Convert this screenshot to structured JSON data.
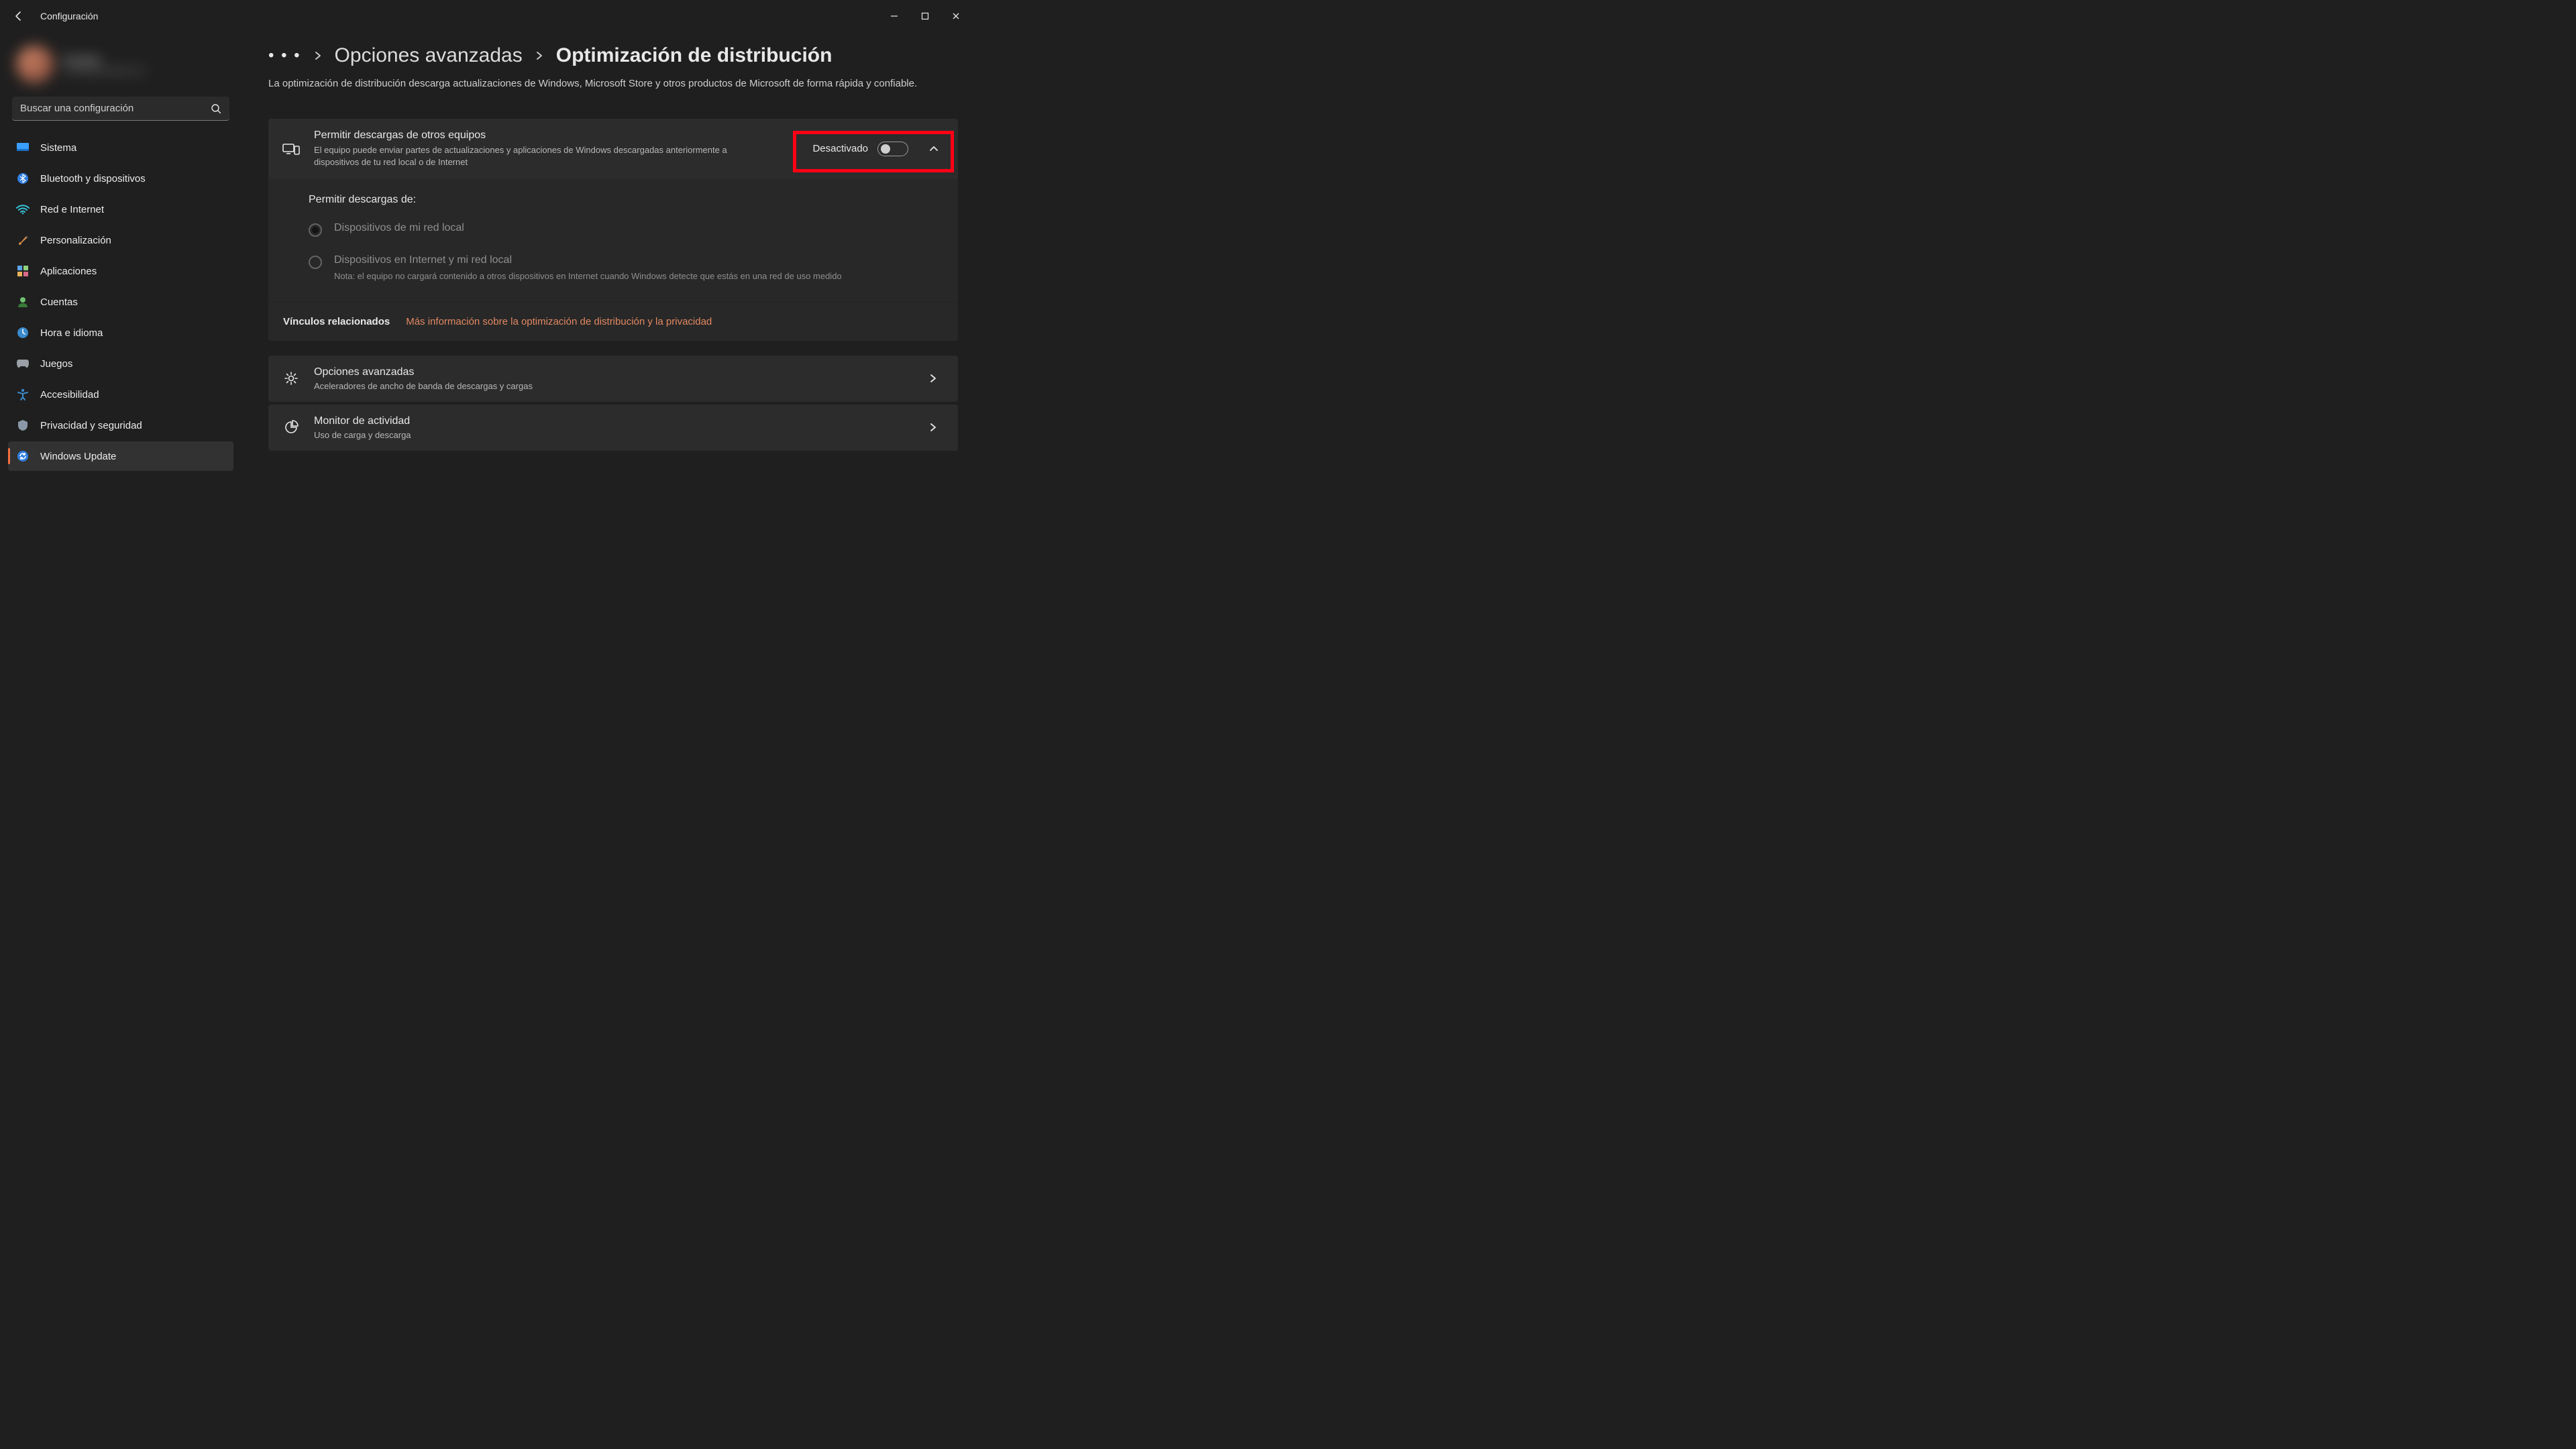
{
  "window": {
    "app_title": "Configuración"
  },
  "account": {
    "name": "Usuario",
    "email": "usuario@example.com"
  },
  "search": {
    "placeholder": "Buscar una configuración"
  },
  "sidebar": {
    "items": [
      {
        "id": "system",
        "label": "Sistema"
      },
      {
        "id": "bluetooth",
        "label": "Bluetooth y dispositivos"
      },
      {
        "id": "network",
        "label": "Red e Internet"
      },
      {
        "id": "personalization",
        "label": "Personalización"
      },
      {
        "id": "apps",
        "label": "Aplicaciones"
      },
      {
        "id": "accounts",
        "label": "Cuentas"
      },
      {
        "id": "time",
        "label": "Hora e idioma"
      },
      {
        "id": "gaming",
        "label": "Juegos"
      },
      {
        "id": "accessibility",
        "label": "Accesibilidad"
      },
      {
        "id": "privacy",
        "label": "Privacidad y seguridad"
      },
      {
        "id": "update",
        "label": "Windows Update"
      }
    ],
    "active": "update"
  },
  "breadcrumb": {
    "link": "Opciones avanzadas",
    "current": "Optimización de distribución"
  },
  "intro": "La optimización de distribución descarga actualizaciones de Windows, Microsoft Store y otros productos de Microsoft de forma rápida y confiable.",
  "allow": {
    "title": "Permitir descargas de otros equipos",
    "desc": "El equipo puede enviar partes de actualizaciones y aplicaciones de Windows descargadas anteriormente a dispositivos de tu red local o de Internet",
    "state_label": "Desactivado",
    "value": false
  },
  "sub": {
    "heading": "Permitir descargas de:",
    "options": [
      {
        "label": "Dispositivos de mi red local",
        "selected": true
      },
      {
        "label": "Dispositivos en Internet y mi red local",
        "note": "Nota: el equipo no cargará contenido a otros dispositivos en Internet cuando Windows detecte que estás en una red de uso medido",
        "selected": false
      }
    ]
  },
  "related": {
    "heading": "Vínculos relacionados",
    "link": "Más información sobre la optimización de distribución y la privacidad"
  },
  "rows": [
    {
      "id": "advanced",
      "title": "Opciones avanzadas",
      "desc": "Aceleradores de ancho de banda de descargas y cargas"
    },
    {
      "id": "activity",
      "title": "Monitor de actividad",
      "desc": "Uso de carga y descarga"
    }
  ]
}
